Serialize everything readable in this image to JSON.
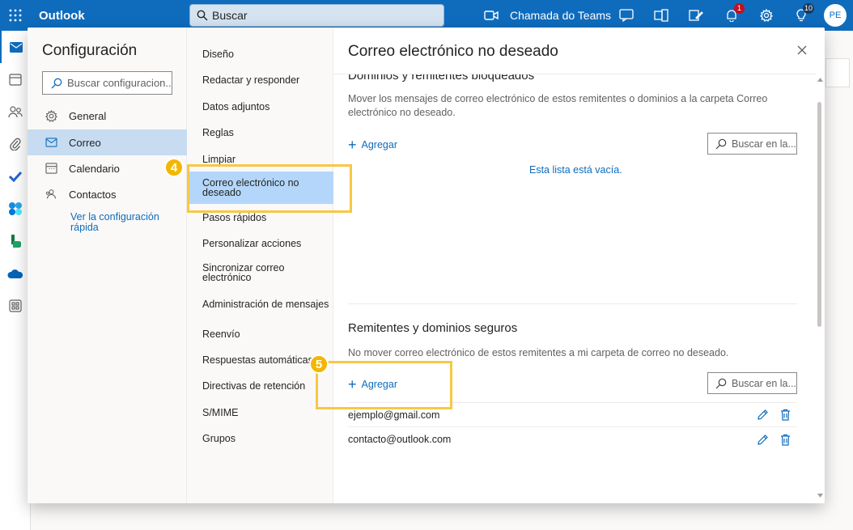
{
  "topbar": {
    "brand": "Outlook",
    "search_placeholder": "Buscar",
    "teams_label": "Chamada do Teams",
    "notifications_count": "1",
    "tips_count": "10",
    "avatar_initials": "PE"
  },
  "settings": {
    "title": "Configuración",
    "search_placeholder": "Buscar configuracion...",
    "categories": [
      {
        "label": "General",
        "icon": "gear-icon"
      },
      {
        "label": "Correo",
        "icon": "mail-icon"
      },
      {
        "label": "Calendario",
        "icon": "calendar-icon"
      },
      {
        "label": "Contactos",
        "icon": "people-icon"
      }
    ],
    "quick_settings_link": "Ver la configuración rápida",
    "subcategories": [
      "Diseño",
      "Redactar y responder",
      "Datos adjuntos",
      "Reglas",
      "Limpiar",
      "Correo electrónico no deseado",
      "Pasos rápidos",
      "Personalizar acciones",
      "Sincronizar correo electrónico",
      "Administración de mensajes",
      "Reenvío",
      "Respuestas automáticas",
      "Directivas de retención",
      "S/MIME",
      "Grupos"
    ]
  },
  "pane": {
    "title": "Correo electrónico no deseado",
    "blocked": {
      "heading": "Dominios y remitentes bloqueados",
      "description": "Mover los mensajes de correo electrónico de estos remitentes o dominios a la carpeta Correo electrónico no deseado.",
      "add_label": "Agregar",
      "search_placeholder": "Buscar en la...",
      "empty_text": "Esta lista está vacía."
    },
    "safe": {
      "heading": "Remitentes y dominios seguros",
      "description": "No mover correo electrónico de estos remitentes a mi carpeta de correo no deseado.",
      "add_label": "Agregar",
      "search_placeholder": "Buscar en la...",
      "entries": [
        "ejemplo@gmail.com",
        "contacto@outlook.com"
      ]
    }
  },
  "annotations": {
    "step4": "4",
    "step5": "5",
    "highlight_color": "#f7c844"
  },
  "colors": {
    "brand": "#0f6cbd",
    "selected_category": "#c7dcf1",
    "selected_subcategory": "#b4d6fa"
  }
}
